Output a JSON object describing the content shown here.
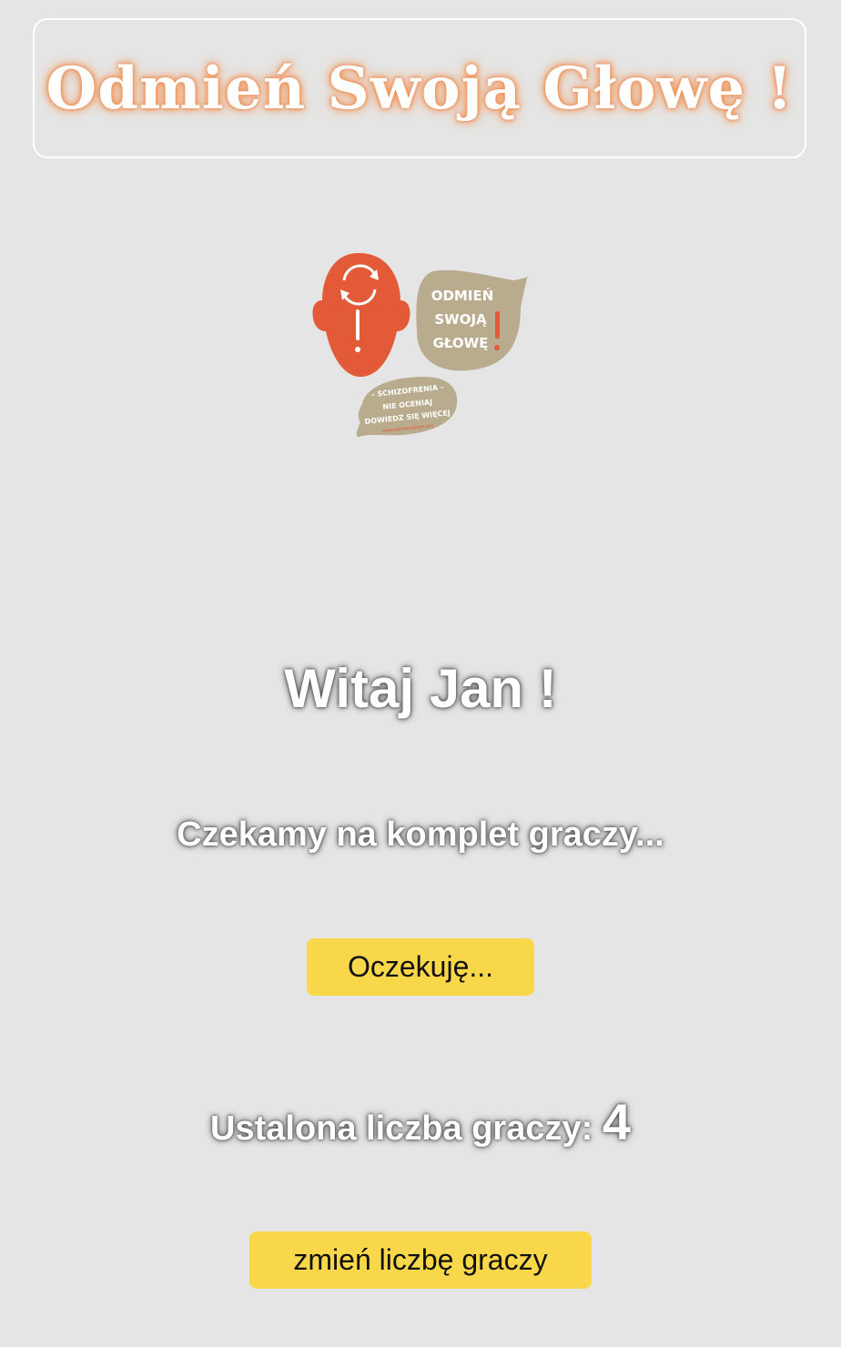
{
  "header": {
    "title": "Odmień Swoją Głowę !"
  },
  "logo": {
    "bubble_lines": [
      "ODMIEŃ",
      "SWOJĄ",
      "GŁOWĘ"
    ],
    "small_bubble_lines": [
      "– SCHIZOFRENIA –",
      "NIE OCENIAJ",
      "DOWIEDZ SIĘ WIĘCEJ",
      "www.odmienglowe.org"
    ],
    "head_color": "#e25a37",
    "bubble_color": "#b9ab8d"
  },
  "main": {
    "greeting": "Witaj Jan !",
    "waiting_text": "Czekamy na komplet graczy...",
    "wait_button_label": "Oczekuję...",
    "players_label": "Ustalona liczba graczy:",
    "players_count": "4",
    "change_button_label": "zmień liczbę graczy"
  },
  "colors": {
    "background": "#e5e5e5",
    "button": "#f8d84a",
    "title_glow": "#f08a4b"
  }
}
